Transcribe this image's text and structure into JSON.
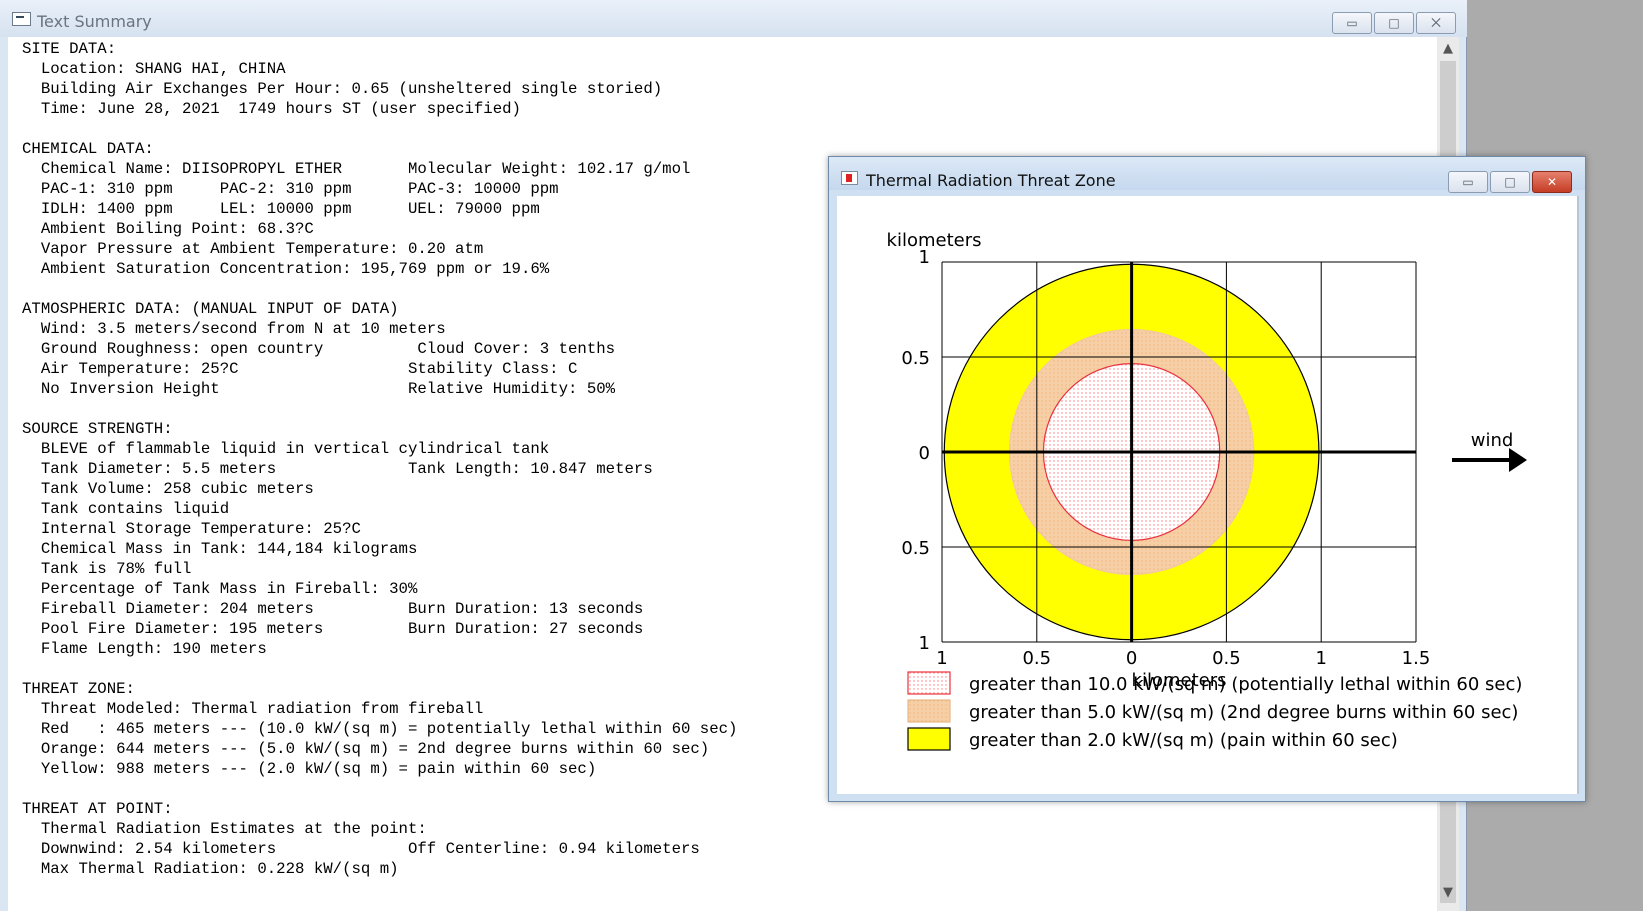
{
  "text_summary": {
    "title": "Text Summary",
    "window_buttons": {
      "minimize": "▭",
      "maximize": "□",
      "close": "⨉"
    },
    "scroll": {
      "up": "▲",
      "down": "▼"
    },
    "lines": [
      "SITE DATA:",
      "  Location: SHANG HAI, CHINA",
      "  Building Air Exchanges Per Hour: 0.65 (unsheltered single storied)",
      "  Time: June 28, 2021  1749 hours ST (user specified)",
      "",
      "CHEMICAL DATA:",
      "  Chemical Name: DIISOPROPYL ETHER       Molecular Weight: 102.17 g/mol",
      "  PAC-1: 310 ppm     PAC-2: 310 ppm      PAC-3: 10000 ppm",
      "  IDLH: 1400 ppm     LEL: 10000 ppm      UEL: 79000 ppm",
      "  Ambient Boiling Point: 68.3?C",
      "  Vapor Pressure at Ambient Temperature: 0.20 atm",
      "  Ambient Saturation Concentration: 195,769 ppm or 19.6%",
      "",
      "ATMOSPHERIC DATA: (MANUAL INPUT OF DATA)",
      "  Wind: 3.5 meters/second from N at 10 meters",
      "  Ground Roughness: open country          Cloud Cover: 3 tenths",
      "  Air Temperature: 25?C                  Stability Class: C",
      "  No Inversion Height                    Relative Humidity: 50%",
      "",
      "SOURCE STRENGTH:",
      "  BLEVE of flammable liquid in vertical cylindrical tank",
      "  Tank Diameter: 5.5 meters              Tank Length: 10.847 meters",
      "  Tank Volume: 258 cubic meters",
      "  Tank contains liquid",
      "  Internal Storage Temperature: 25?C",
      "  Chemical Mass in Tank: 144,184 kilograms",
      "  Tank is 78% full",
      "  Percentage of Tank Mass in Fireball: 30%",
      "  Fireball Diameter: 204 meters          Burn Duration: 13 seconds",
      "  Pool Fire Diameter: 195 meters         Burn Duration: 27 seconds",
      "  Flame Length: 190 meters",
      "",
      "THREAT ZONE:",
      "  Threat Modeled: Thermal radiation from fireball",
      "  Red   : 465 meters --- (10.0 kW/(sq m) = potentially lethal within 60 sec)",
      "  Orange: 644 meters --- (5.0 kW/(sq m) = 2nd degree burns within 60 sec)",
      "  Yellow: 988 meters --- (2.0 kW/(sq m) = pain within 60 sec)",
      "",
      "THREAT AT POINT:",
      "  Thermal Radiation Estimates at the point:",
      "  Downwind: 2.54 kilometers              Off Centerline: 0.94 kilometers",
      "  Max Thermal Radiation: 0.228 kW/(sq m)"
    ]
  },
  "threat_zone": {
    "title": "Thermal Radiation Threat Zone",
    "window_buttons": {
      "minimize": "▭",
      "maximize": "□",
      "close": "✕"
    },
    "wind_label": "wind",
    "colors": {
      "red": "#e8323c",
      "orange": "#f7cfa6",
      "yellow": "#ffff00",
      "grid": "#000000",
      "dot": "#ff7a7a"
    },
    "chart_data": {
      "type": "threat-zone",
      "xlabel": "kilometers",
      "ylabel": "kilometers",
      "xlim": [
        -1,
        1.5
      ],
      "ylim": [
        -1,
        1
      ],
      "x_ticks": [
        "1",
        "0.5",
        "0",
        "0.5",
        "1",
        "1.5"
      ],
      "y_ticks": [
        "1",
        "0.5",
        "0",
        "0.5",
        "1"
      ],
      "zones": [
        {
          "name": "yellow",
          "radius_km": 0.988
        },
        {
          "name": "orange",
          "radius_km": 0.644
        },
        {
          "name": "red",
          "radius_km": 0.465
        }
      ]
    },
    "legend": [
      {
        "key": "red",
        "label": "greater than 10.0 kW/(sq m) (potentially lethal within 60 sec)"
      },
      {
        "key": "orange",
        "label": "greater than 5.0 kW/(sq m) (2nd degree burns within 60 sec)"
      },
      {
        "key": "yellow",
        "label": "greater than 2.0 kW/(sq m) (pain within 60 sec)"
      }
    ]
  }
}
